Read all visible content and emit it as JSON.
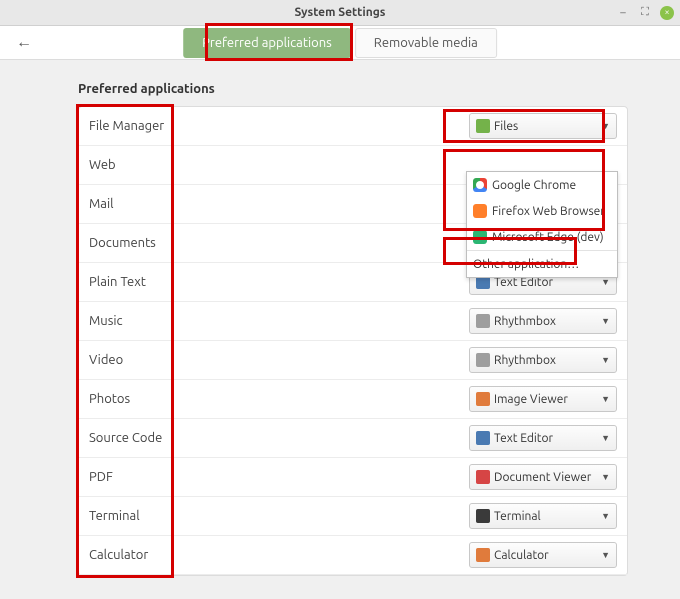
{
  "window": {
    "title": "System Settings"
  },
  "tabs": {
    "preferred": "Preferred applications",
    "removable": "Removable media"
  },
  "section_title": "Preferred applications",
  "rows": [
    {
      "label": "File Manager",
      "app": "Files",
      "icon": "folder-icon",
      "icon_cls": "ic-green"
    },
    {
      "label": "Web",
      "app": "",
      "icon": "",
      "icon_cls": ""
    },
    {
      "label": "Mail",
      "app": "",
      "icon": "",
      "icon_cls": ""
    },
    {
      "label": "Documents",
      "app": "",
      "icon": "",
      "icon_cls": ""
    },
    {
      "label": "Plain Text",
      "app": "Text Editor",
      "icon": "text-icon",
      "icon_cls": "ic-blue"
    },
    {
      "label": "Music",
      "app": "Rhythmbox",
      "icon": "music-icon",
      "icon_cls": "ic-gray"
    },
    {
      "label": "Video",
      "app": "Rhythmbox",
      "icon": "music-icon",
      "icon_cls": "ic-gray"
    },
    {
      "label": "Photos",
      "app": "Image Viewer",
      "icon": "image-icon",
      "icon_cls": "ic-orange"
    },
    {
      "label": "Source Code",
      "app": "Text Editor",
      "icon": "text-icon",
      "icon_cls": "ic-blue"
    },
    {
      "label": "PDF",
      "app": "Document Viewer",
      "icon": "pdf-icon",
      "icon_cls": "ic-red"
    },
    {
      "label": "Terminal",
      "app": "Terminal",
      "icon": "terminal-icon",
      "icon_cls": "ic-dark"
    },
    {
      "label": "Calculator",
      "app": "Calculator",
      "icon": "calc-icon",
      "icon_cls": "ic-orange"
    }
  ],
  "web_popup": {
    "items": [
      {
        "label": "Google Chrome",
        "icon": "chrome-icon",
        "icon_cls": "ic-chrome"
      },
      {
        "label": "Firefox Web Browser",
        "icon": "firefox-icon",
        "icon_cls": "ic-ff"
      },
      {
        "label": "Microsoft Edge (dev)",
        "icon": "edge-icon",
        "icon_cls": "ic-edge"
      }
    ],
    "other": "Other application…"
  }
}
